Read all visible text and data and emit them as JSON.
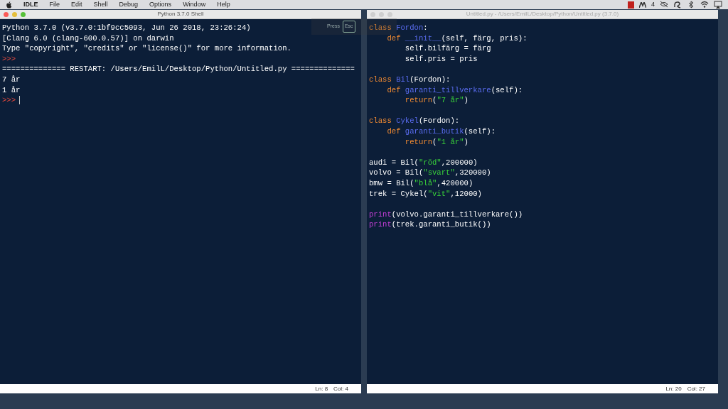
{
  "menu_bar": {
    "app": "IDLE",
    "items": [
      "File",
      "Edit",
      "Shell",
      "Debug",
      "Options",
      "Window",
      "Help"
    ],
    "status_badge": "4"
  },
  "windows": [
    {
      "title": "Python 3.7.0 Shell",
      "active": true,
      "kind": "shell",
      "lines": [
        {
          "kind": "output",
          "text": "Python 3.7.0 (v3.7.0:1bf9cc5093, Jun 26 2018, 23:26:24)"
        },
        {
          "kind": "output",
          "text": "[Clang 6.0 (clang-600.0.57)] on darwin"
        },
        {
          "kind": "output",
          "text": "Type \"copyright\", \"credits\" or \"license()\" for more information."
        },
        {
          "kind": "prompt",
          "text": ">>>"
        },
        {
          "kind": "output",
          "text": "============== RESTART: /Users/EmilL/Desktop/Python/Untitled.py =============="
        },
        {
          "kind": "output",
          "text": "7 år"
        },
        {
          "kind": "output",
          "text": "1 år"
        },
        {
          "kind": "prompt",
          "text": ">>>",
          "cursor": true
        }
      ],
      "status": {
        "line": "Ln: 8",
        "col": "Col: 4"
      }
    },
    {
      "title": "Untitled.py - /Users/EmilL/Desktop/Python/Untitled.py (3.7.0)",
      "active": false,
      "kind": "editor",
      "code": [
        {
          "tokens": [
            {
              "kind": "keyword",
              "text": "class "
            },
            {
              "kind": "name",
              "text": "Fordon"
            },
            {
              "kind": "plain",
              "text": ":"
            }
          ]
        },
        {
          "tokens": [
            {
              "kind": "keyword",
              "text": "    def "
            },
            {
              "kind": "name",
              "text": "__init__"
            },
            {
              "kind": "plain",
              "text": "(self, färg, pris):"
            }
          ]
        },
        {
          "tokens": [
            {
              "kind": "plain",
              "text": "        self.bilfärg = färg"
            }
          ]
        },
        {
          "tokens": [
            {
              "kind": "plain",
              "text": "        self.pris = pris"
            }
          ]
        },
        {
          "blank_before": true,
          "tokens": [
            {
              "kind": "keyword",
              "text": "class "
            },
            {
              "kind": "name",
              "text": "Bil"
            },
            {
              "kind": "plain",
              "text": "(Fordon):"
            }
          ]
        },
        {
          "tokens": [
            {
              "kind": "keyword",
              "text": "    def "
            },
            {
              "kind": "name",
              "text": "garanti_tillverkare"
            },
            {
              "kind": "plain",
              "text": "(self):"
            }
          ]
        },
        {
          "tokens": [
            {
              "kind": "keyword",
              "text": "        return"
            },
            {
              "kind": "plain",
              "text": "("
            },
            {
              "kind": "string",
              "text": "\"7 år\""
            },
            {
              "kind": "plain",
              "text": ")"
            }
          ]
        },
        {
          "blank_before": true,
          "tokens": [
            {
              "kind": "keyword",
              "text": "class "
            },
            {
              "kind": "name",
              "text": "Cykel"
            },
            {
              "kind": "plain",
              "text": "(Fordon):"
            }
          ]
        },
        {
          "tokens": [
            {
              "kind": "keyword",
              "text": "    def "
            },
            {
              "kind": "name",
              "text": "garanti_butik"
            },
            {
              "kind": "plain",
              "text": "(self):"
            }
          ]
        },
        {
          "tokens": [
            {
              "kind": "keyword",
              "text": "        return"
            },
            {
              "kind": "plain",
              "text": "("
            },
            {
              "kind": "string",
              "text": "\"1 år\""
            },
            {
              "kind": "plain",
              "text": ")"
            }
          ]
        },
        {
          "blank_before": true,
          "tokens": [
            {
              "kind": "plain",
              "text": "audi = Bil("
            },
            {
              "kind": "string",
              "text": "\"röd\""
            },
            {
              "kind": "plain",
              "text": ",200000)"
            }
          ]
        },
        {
          "tokens": [
            {
              "kind": "plain",
              "text": "volvo = Bil("
            },
            {
              "kind": "string",
              "text": "\"svart\""
            },
            {
              "kind": "plain",
              "text": ",320000)"
            }
          ]
        },
        {
          "tokens": [
            {
              "kind": "plain",
              "text": "bmw = Bil("
            },
            {
              "kind": "string",
              "text": "\"blå\""
            },
            {
              "kind": "plain",
              "text": ",420000)"
            }
          ]
        },
        {
          "tokens": [
            {
              "kind": "plain",
              "text": "trek = Cykel("
            },
            {
              "kind": "string",
              "text": "\"vit\""
            },
            {
              "kind": "plain",
              "text": ",12000)"
            }
          ]
        },
        {
          "blank_before": true,
          "tokens": [
            {
              "kind": "builtin",
              "text": "print"
            },
            {
              "kind": "plain",
              "text": "(volvo.garanti_tillverkare())"
            }
          ]
        },
        {
          "tokens": [
            {
              "kind": "builtin",
              "text": "print"
            },
            {
              "kind": "plain",
              "text": "(trek.garanti_butik())"
            }
          ]
        }
      ],
      "status": {
        "line": "Ln: 20",
        "col": "Col: 27"
      }
    }
  ],
  "fullscreen_hint": {
    "text": "Press",
    "key": "Esc"
  }
}
